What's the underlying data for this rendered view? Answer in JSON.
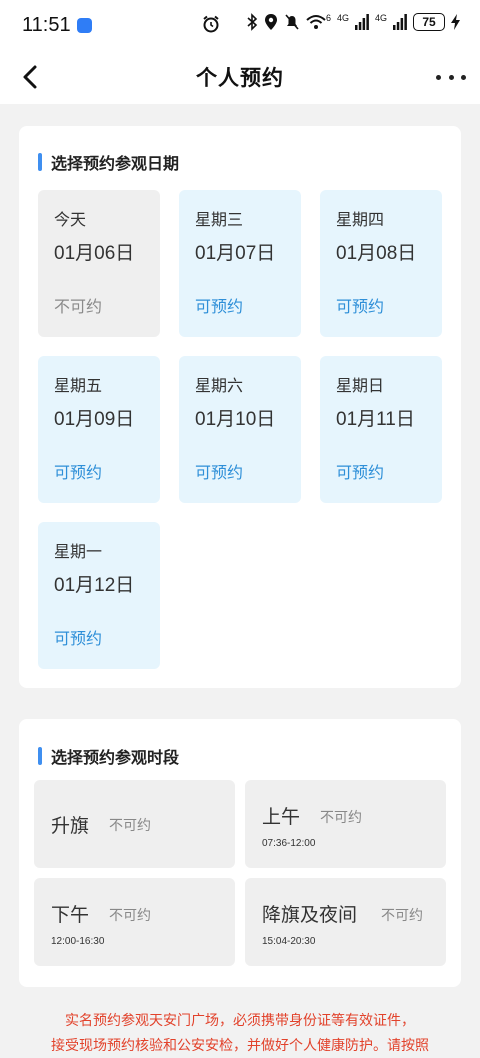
{
  "status_bar": {
    "time": "11:51",
    "network_6": "6",
    "network_4g_1": "4G",
    "network_4g_2": "4G",
    "battery": "75"
  },
  "header": {
    "title": "个人预约"
  },
  "date_section": {
    "title": "选择预约参观日期",
    "dates": [
      {
        "week": "今天",
        "date": "01月06日",
        "status": "不可约",
        "available": false
      },
      {
        "week": "星期三",
        "date": "01月07日",
        "status": "可预约",
        "available": true
      },
      {
        "week": "星期四",
        "date": "01月08日",
        "status": "可预约",
        "available": true
      },
      {
        "week": "星期五",
        "date": "01月09日",
        "status": "可预约",
        "available": true
      },
      {
        "week": "星期六",
        "date": "01月10日",
        "status": "可预约",
        "available": true
      },
      {
        "week": "星期日",
        "date": "01月11日",
        "status": "可预约",
        "available": true
      },
      {
        "week": "星期一",
        "date": "01月12日",
        "status": "可预约",
        "available": true
      }
    ]
  },
  "time_section": {
    "title": "选择预约参观时段",
    "slots": [
      {
        "name": "升旗",
        "status": "不可约",
        "time": ""
      },
      {
        "name": "上午",
        "status": "不可约",
        "time": "07:36-12:00"
      },
      {
        "name": "下午",
        "status": "不可约",
        "time": "12:00-16:30"
      },
      {
        "name": "降旗及夜间",
        "status": "不可约",
        "time": "15:04-20:30"
      }
    ]
  },
  "notice": {
    "line1": "实名预约参观天安门广场，必须携带身份证等有效证件，",
    "line2": "接受现场预约核验和公安安检，并做好个人健康防护。请按照"
  },
  "colors": {
    "accent": "#3f8ff0",
    "available_bg": "#e6f5fd",
    "available_text": "#2e8fd8",
    "notice_text": "#e2422b"
  }
}
